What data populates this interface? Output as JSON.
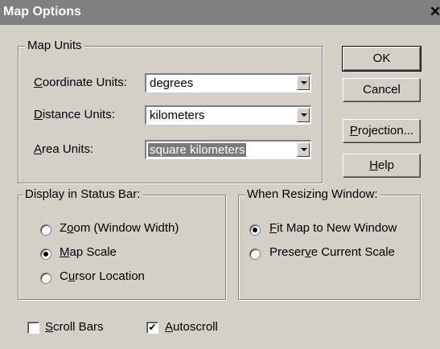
{
  "window": {
    "title": "Map Options",
    "close_glyph": "✕"
  },
  "map_units": {
    "legend": "Map Units",
    "coordinate": {
      "label_pre": "",
      "label_u": "C",
      "label_post": "oordinate Units:",
      "value": "degrees"
    },
    "distance": {
      "label_pre": "",
      "label_u": "D",
      "label_post": "istance Units:",
      "value": "kilometers"
    },
    "area": {
      "label_pre": "",
      "label_u": "A",
      "label_post": "rea Units:",
      "value": "square kilometers"
    }
  },
  "buttons": {
    "ok": "OK",
    "cancel": "Cancel",
    "projection": {
      "pre": "",
      "u": "P",
      "post": "rojection..."
    },
    "help": {
      "pre": "",
      "u": "H",
      "post": "elp"
    }
  },
  "status_bar": {
    "legend": "Display in Status Bar:",
    "zoom": {
      "pre": "Z",
      "u": "o",
      "post": "om (Window Width)",
      "checked": false
    },
    "scale": {
      "pre": "",
      "u": "M",
      "post": "ap Scale",
      "checked": true
    },
    "cursor": {
      "pre": "C",
      "u": "u",
      "post": "rsor Location",
      "checked": false
    }
  },
  "resizing": {
    "legend": "When Resizing Window:",
    "fit": {
      "pre": "",
      "u": "F",
      "post": "it Map to New Window",
      "checked": true
    },
    "preserve": {
      "pre": "Preser",
      "u": "v",
      "post": "e Current Scale",
      "checked": false
    }
  },
  "options": {
    "scroll_bars": {
      "pre": "",
      "u": "S",
      "post": "croll Bars",
      "checked": false
    },
    "autoscroll": {
      "pre": "",
      "u": "A",
      "post": "utoscroll",
      "checked": true
    }
  },
  "colors": {
    "face": "#d4d0c8",
    "title_bar": "#808080",
    "selection": "#7a7a7a"
  },
  "icons": {
    "check_glyph": "✔",
    "dropdown": "chevron-down-icon"
  }
}
